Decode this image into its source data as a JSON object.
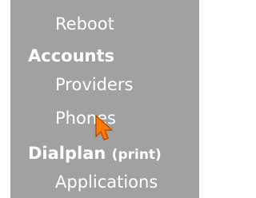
{
  "menu": {
    "items": [
      {
        "label": "Reboot"
      },
      {
        "label": "Accounts"
      },
      {
        "label": "Providers"
      },
      {
        "label": "Phones"
      },
      {
        "label": "Dialplan",
        "suffix": "(print)"
      },
      {
        "label": "Applications"
      }
    ]
  },
  "colors": {
    "panel_background": "#a1a1a1",
    "text": "#ffffff",
    "cursor_fill": "#ff7a00",
    "cursor_outline": "#c04a00"
  },
  "icons": {
    "cursor": "arrow-pointer-icon"
  }
}
